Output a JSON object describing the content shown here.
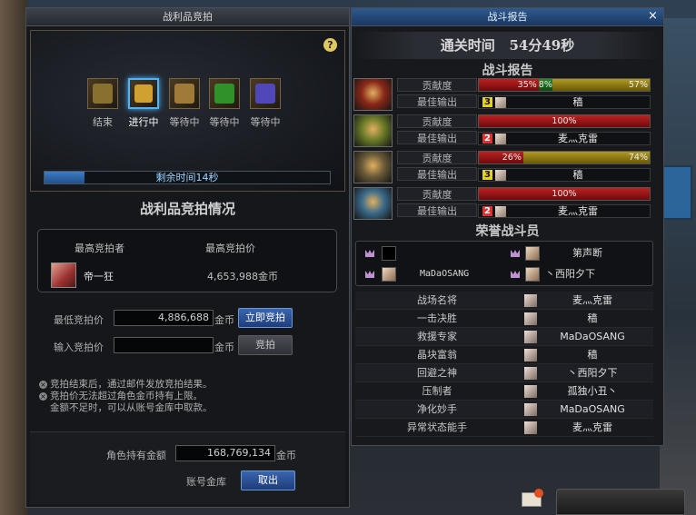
{
  "auction": {
    "title": "战利品竞拍",
    "help": "?",
    "steps": [
      {
        "label": "结束",
        "color": "#c0a040"
      },
      {
        "label": "进行中",
        "color": "#e0b030",
        "active": true
      },
      {
        "label": "等待中",
        "color": "#c09040"
      },
      {
        "label": "等待中",
        "color": "#40a040"
      },
      {
        "label": "等待中",
        "color": "#6050c0"
      }
    ],
    "progress": 0.14,
    "remaining": "剩余时间14秒",
    "section_title": "战利品竞拍情况",
    "col_bidder": "最高竞拍者",
    "col_price": "最高竞拍价",
    "bidder_name": "帝一狂",
    "bidder_price": "4,653,988金币",
    "min_label": "最低竞拍价",
    "min_value": "4,886,688",
    "unit": "金币",
    "instant_btn": "立即竞拍",
    "input_label": "输入竞拍价",
    "input_value": "",
    "bid_btn": "竞拍",
    "notes": [
      "竞拍结束后，通过邮件发放竞拍结果。",
      "竞拍价无法超过角色金币持有上限。",
      "金额不足时，可以从账号金库中取款。"
    ],
    "gold_label": "角色持有金额",
    "gold_value": "168,769,134",
    "vault_label": "账号金库",
    "withdraw_btn": "取出"
  },
  "report": {
    "title": "战斗报告",
    "close": "×",
    "clear_label": "通关时间",
    "clear_time": "54分49秒",
    "subhead": "战斗报告",
    "contrib_label": "贡献度",
    "best_label": "最佳输出",
    "players": [
      {
        "segments": [
          {
            "type": "red",
            "pct": 35,
            "label": "35%"
          },
          {
            "type": "green",
            "pct": 8,
            "label": "8%"
          },
          {
            "type": "gold",
            "pct": 57,
            "label": "57%"
          }
        ],
        "rank": "3",
        "name": "穑",
        "portrait": "#8a2818"
      },
      {
        "segments": [
          {
            "type": "red",
            "pct": 100,
            "label": "100%"
          }
        ],
        "rank": "2",
        "name": "麦灬克雷",
        "portrait": "#6a7a28"
      },
      {
        "segments": [
          {
            "type": "red",
            "pct": 26,
            "label": "26%"
          },
          {
            "type": "gold",
            "pct": 74,
            "label": "74%"
          }
        ],
        "rank": "3",
        "name": "穑",
        "portrait": "#6a5a38"
      },
      {
        "segments": [
          {
            "type": "red",
            "pct": 100,
            "label": "100%"
          }
        ],
        "rank": "2",
        "name": "麦灬克雷",
        "portrait": "#3a6a8a"
      }
    ],
    "honor_title": "荣誉战斗员",
    "honor": [
      {
        "name": ""
      },
      {
        "name": "第声断"
      },
      {
        "name": "MaDaOSANG"
      },
      {
        "name": "丶西阳夕下"
      }
    ],
    "awards": [
      {
        "title": "战场名将",
        "name": "麦灬克雷"
      },
      {
        "title": "一击决胜",
        "name": "穑"
      },
      {
        "title": "救援专家",
        "name": "MaDaOSANG"
      },
      {
        "title": "晶块富翁",
        "name": "穑"
      },
      {
        "title": "回避之神",
        "name": "丶西阳夕下"
      },
      {
        "title": "压制者",
        "name": "孤独小丑丶"
      },
      {
        "title": "净化妙手",
        "name": "MaDaOSANG"
      },
      {
        "title": "异常状态能手",
        "name": "麦灬克雷"
      }
    ]
  }
}
